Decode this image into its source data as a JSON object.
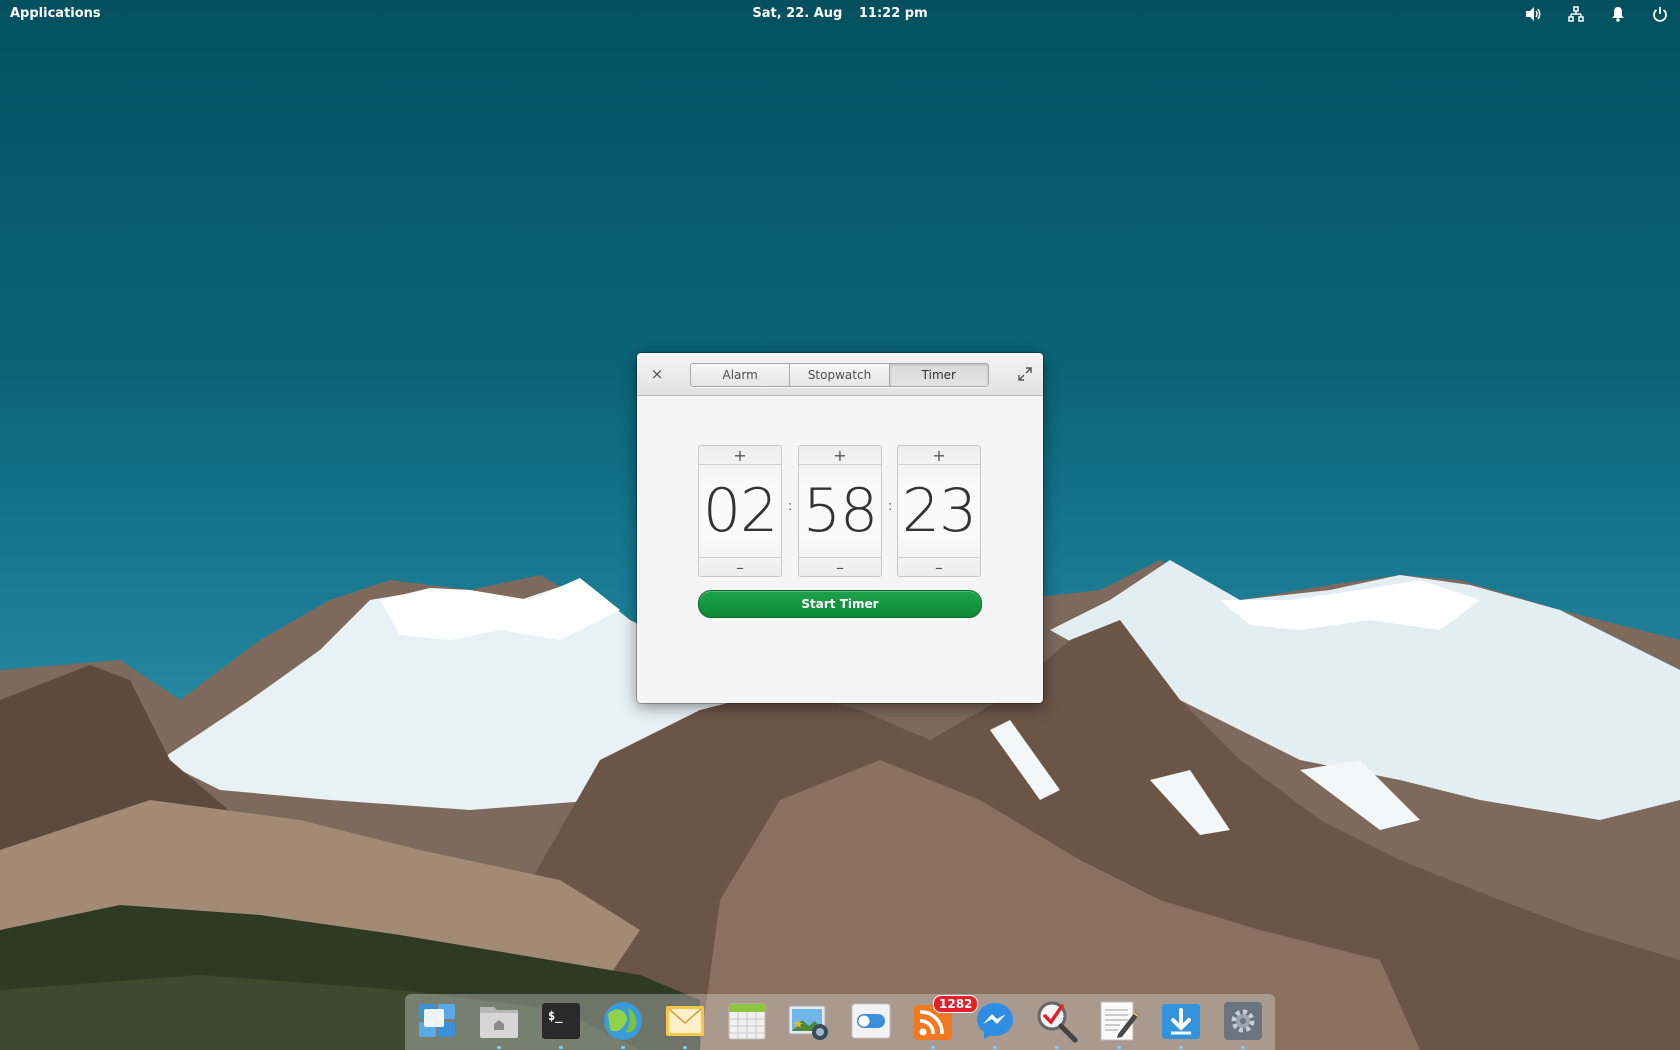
{
  "top_panel": {
    "applications_label": "Applications",
    "date": "Sat, 22. Aug",
    "time": "11:22 pm",
    "indicators": [
      "volume-icon",
      "network-icon",
      "notifications-icon",
      "power-icon"
    ]
  },
  "clock_window": {
    "tabs": [
      {
        "label": "Alarm",
        "active": false
      },
      {
        "label": "Stopwatch",
        "active": false
      },
      {
        "label": "Timer",
        "active": true
      }
    ],
    "timer": {
      "hours": "02",
      "minutes": "58",
      "seconds": "23",
      "separator": ":",
      "plus_symbol": "+",
      "minus_symbol": "–",
      "start_label": "Start Timer"
    },
    "close_symbol": "×"
  },
  "dock": {
    "items": [
      {
        "name": "multitasking-view-icon",
        "running": false
      },
      {
        "name": "files-icon",
        "running": true
      },
      {
        "name": "terminal-icon",
        "running": true
      },
      {
        "name": "web-browser-icon",
        "running": true
      },
      {
        "name": "mail-icon",
        "running": true
      },
      {
        "name": "calendar-icon",
        "running": false
      },
      {
        "name": "photos-icon",
        "running": false
      },
      {
        "name": "switchboard-toggle-icon",
        "running": false
      },
      {
        "name": "rss-reader-icon",
        "running": true
      },
      {
        "name": "messenger-icon",
        "running": true
      },
      {
        "name": "search-check-icon",
        "running": true
      },
      {
        "name": "text-editor-icon",
        "running": true
      },
      {
        "name": "downloads-icon",
        "running": true
      },
      {
        "name": "system-settings-icon",
        "running": true
      }
    ],
    "rss_badge": "1282"
  },
  "colors": {
    "accent_green": "#159a42",
    "badge_red": "#e0212a",
    "sky": "#0b6378"
  }
}
